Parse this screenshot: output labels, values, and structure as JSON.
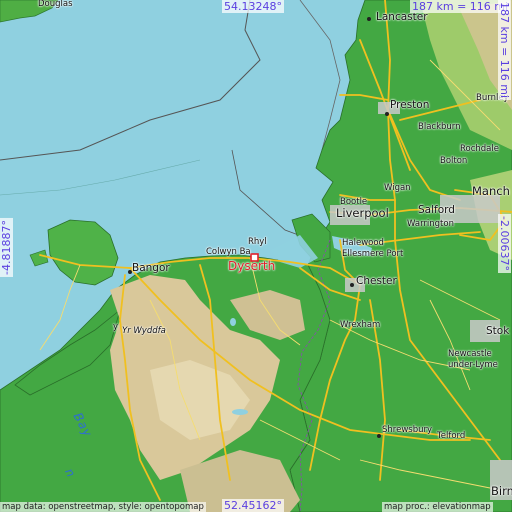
{
  "map": {
    "title": "Dyserth",
    "colors": {
      "sea": "#8fd0e0",
      "lowland": "#43a843",
      "highland": "#d9c89a",
      "road": "#f0c020",
      "focus": "#e0202a",
      "coordinate_text": "#5a3fe0"
    },
    "bounds": {
      "north": "54.13248°",
      "south": "52.45162°",
      "west": "-4.81887°",
      "east": "-2.00637°"
    },
    "scale": {
      "top": "187 km = 116 mi",
      "right": "187 km = 116 mi"
    },
    "credits": {
      "left": "map data: openstreetmap, style: opentopomap",
      "right": "map proc.: elevationmap"
    },
    "sea_label": "Bay",
    "sea_label_2": "n",
    "places": {
      "focus": "Dyserth",
      "douglas": "Douglas",
      "lancaster": "Lancaster",
      "preston": "Preston",
      "blackburn": "Blackburn",
      "burnley": "Burnley",
      "rochdale": "Rochdale",
      "bolton": "Bolton",
      "wigan": "Wigan",
      "manchester": "Manch",
      "bootle": "Bootle",
      "liverpool": "Liverpool",
      "salford": "Salford",
      "warrington": "Warrington",
      "halewood": "Halewood",
      "ellesmere_port": "Ellesmere Port",
      "chester": "Chester",
      "wrexham": "Wrexham",
      "stoke": "Stok",
      "newcastle_1": "Newcastle",
      "newcastle_2": "under-Lyme",
      "shrewsbury": "Shrewsbury",
      "telford": "Telford",
      "birmingham": "Birm",
      "bangor": "Bangor",
      "colwyn_bay": "Colwyn Ba",
      "rhyl": "Rhyl",
      "yr_wyddfa": "Yr Wyddfa",
      "y_label": "y"
    }
  }
}
